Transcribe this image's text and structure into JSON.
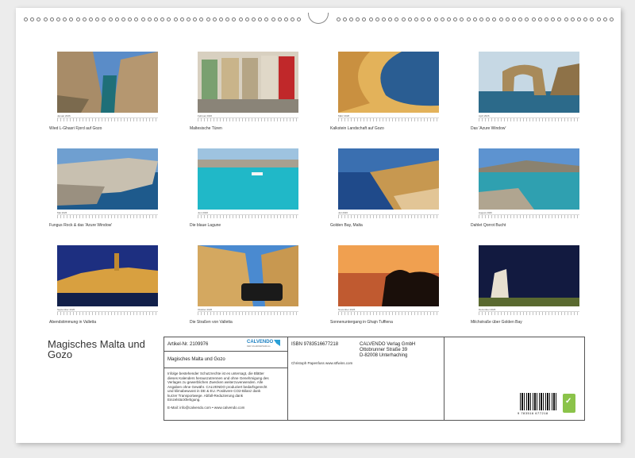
{
  "calendar": {
    "title": "Magisches Malta und Gozo",
    "months": [
      {
        "month": "Januar 2026",
        "caption": "Wied L-Ghasri Fjord auf Gozo"
      },
      {
        "month": "Februar 2026",
        "caption": "Maltesische Türen"
      },
      {
        "month": "März 2026",
        "caption": "Kalkstein Landschaft auf Gozo"
      },
      {
        "month": "April 2026",
        "caption": "Das 'Azure Window'"
      },
      {
        "month": "Mai 2026",
        "caption": "Fungus Rock & das 'Azure Window'"
      },
      {
        "month": "Juni 2026",
        "caption": "Die blaue Lagune"
      },
      {
        "month": "Juli 2026",
        "caption": "Golden Bay, Malta"
      },
      {
        "month": "August 2026",
        "caption": "Dahlet Qorrot Bucht"
      },
      {
        "month": "September 2026",
        "caption": "Abendstimmung in Valletta"
      },
      {
        "month": "Oktober 2026",
        "caption": "Die Straßen von Valletta"
      },
      {
        "month": "November 2026",
        "caption": "Sonnenuntergang in Ghajn Tuffiena"
      },
      {
        "month": "Dezember 2026",
        "caption": "Milchstraße über Golden Bay"
      }
    ]
  },
  "info": {
    "article": "Artikel-Nr. 2109976",
    "product_title": "Magisches Malta und Gozo",
    "legal": "Infolge bestehender Schutzrechte ist es untersagt, die Blätter dieses Kalenders herauszutrennen und ohne Genehmigung des Verlages zu gewerblichen Zwecken weiterzuverwenden. Alle Angaben ohne Gewähr. CALVENDO produziert bedarfsgerecht und klimabewusst in DE & EU. Positivere CO2-Bilanz dank kurzer Transportwege. Abfall-Reduzierung dank Einzelstückfertigung.",
    "email": "E-Mail: info@calvendo.com • www.calvendo.com",
    "isbn": "ISBN 9783516677218",
    "author": "Christoph Papenfuss www.stfwins.com",
    "publisher_name": "CALVENDO Verlag GmbH",
    "publisher_street": "Ottobrunner Straße 39",
    "publisher_city": "D-82008 Unterhaching",
    "logo_text": "CALVENDO",
    "logo_sub": "DER KALENDERVERLAG",
    "barcode_number": "9 783516 677218",
    "eco_badge": "✓"
  },
  "colors": {
    "logo": "#1a7fc1",
    "eco": "#8bc34a"
  }
}
